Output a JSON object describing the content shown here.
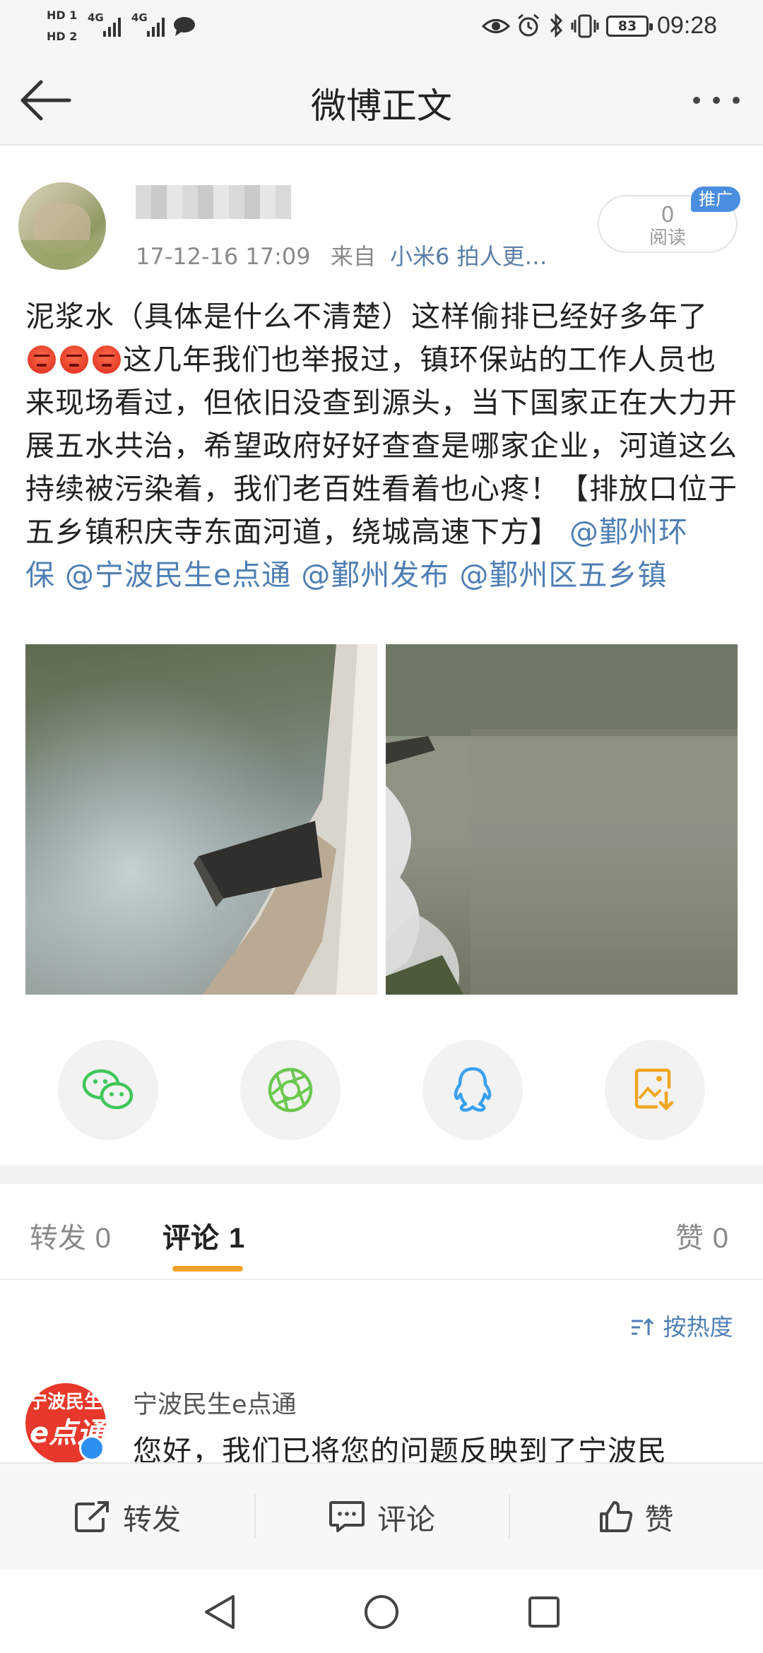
{
  "status_bar": {
    "hd1": "HD 1",
    "hd2": "HD 2",
    "net1": "4G",
    "net2": "4G",
    "battery": "83",
    "time": "09:28",
    "icons": [
      "signal-icon",
      "chat-bubble-icon",
      "eye-icon",
      "alarm-icon",
      "bluetooth-icon",
      "vibrate-icon",
      "battery-icon"
    ]
  },
  "header": {
    "title": "微博正文",
    "back_icon": "back-arrow-icon",
    "more_icon": "more-dots-icon"
  },
  "post": {
    "meta_time": "17-12-16 17:09",
    "meta_from": "来自",
    "meta_source": "小米6 拍人更…",
    "read_count": "0",
    "read_label": "阅读",
    "promo_badge": "推广",
    "text_part1": "泥浆水（具体是什么不清楚）这样偷排已经好多年了",
    "text_part2": "这几年我们也举报过，镇环保站的工作人员也来现场看过，但依旧没查到源头，当下国家正在大力开展五水共治，希望政府好好查查是哪家企业，河道这么持续被污染着，我们老百姓看着也心疼！【排放口位于五乡镇积庆寺东面河道，绕城高速下方】",
    "mentions": [
      "@鄞州环保",
      "@宁波民生e点通",
      "@鄞州发布",
      "@鄞州区五乡镇"
    ]
  },
  "share": {
    "icons": [
      "wechat-icon",
      "moments-icon",
      "qq-icon",
      "save-image-icon"
    ]
  },
  "tabs": {
    "repost_label": "转发",
    "repost_count": "0",
    "comment_label": "评论",
    "comment_count": "1",
    "like_label": "赞",
    "like_count": "0",
    "sort_label": "按热度"
  },
  "comment": {
    "avatar_text": "宁波民生",
    "avatar_e": "e点通",
    "name": "宁波民生e点通",
    "text": "您好，我们已将您的问题反映到了宁波民"
  },
  "actions": {
    "repost": "转发",
    "comment": "评论",
    "like": "赞"
  },
  "colors": {
    "accent_orange": "#f7a32b",
    "link_blue": "#4f7fb4",
    "promo_blue": "#4a8ee0",
    "wechat_green": "#3fc75a",
    "moments_green": "#6cc850",
    "qq_blue": "#3aa0f0",
    "save_orange": "#f0a621"
  }
}
